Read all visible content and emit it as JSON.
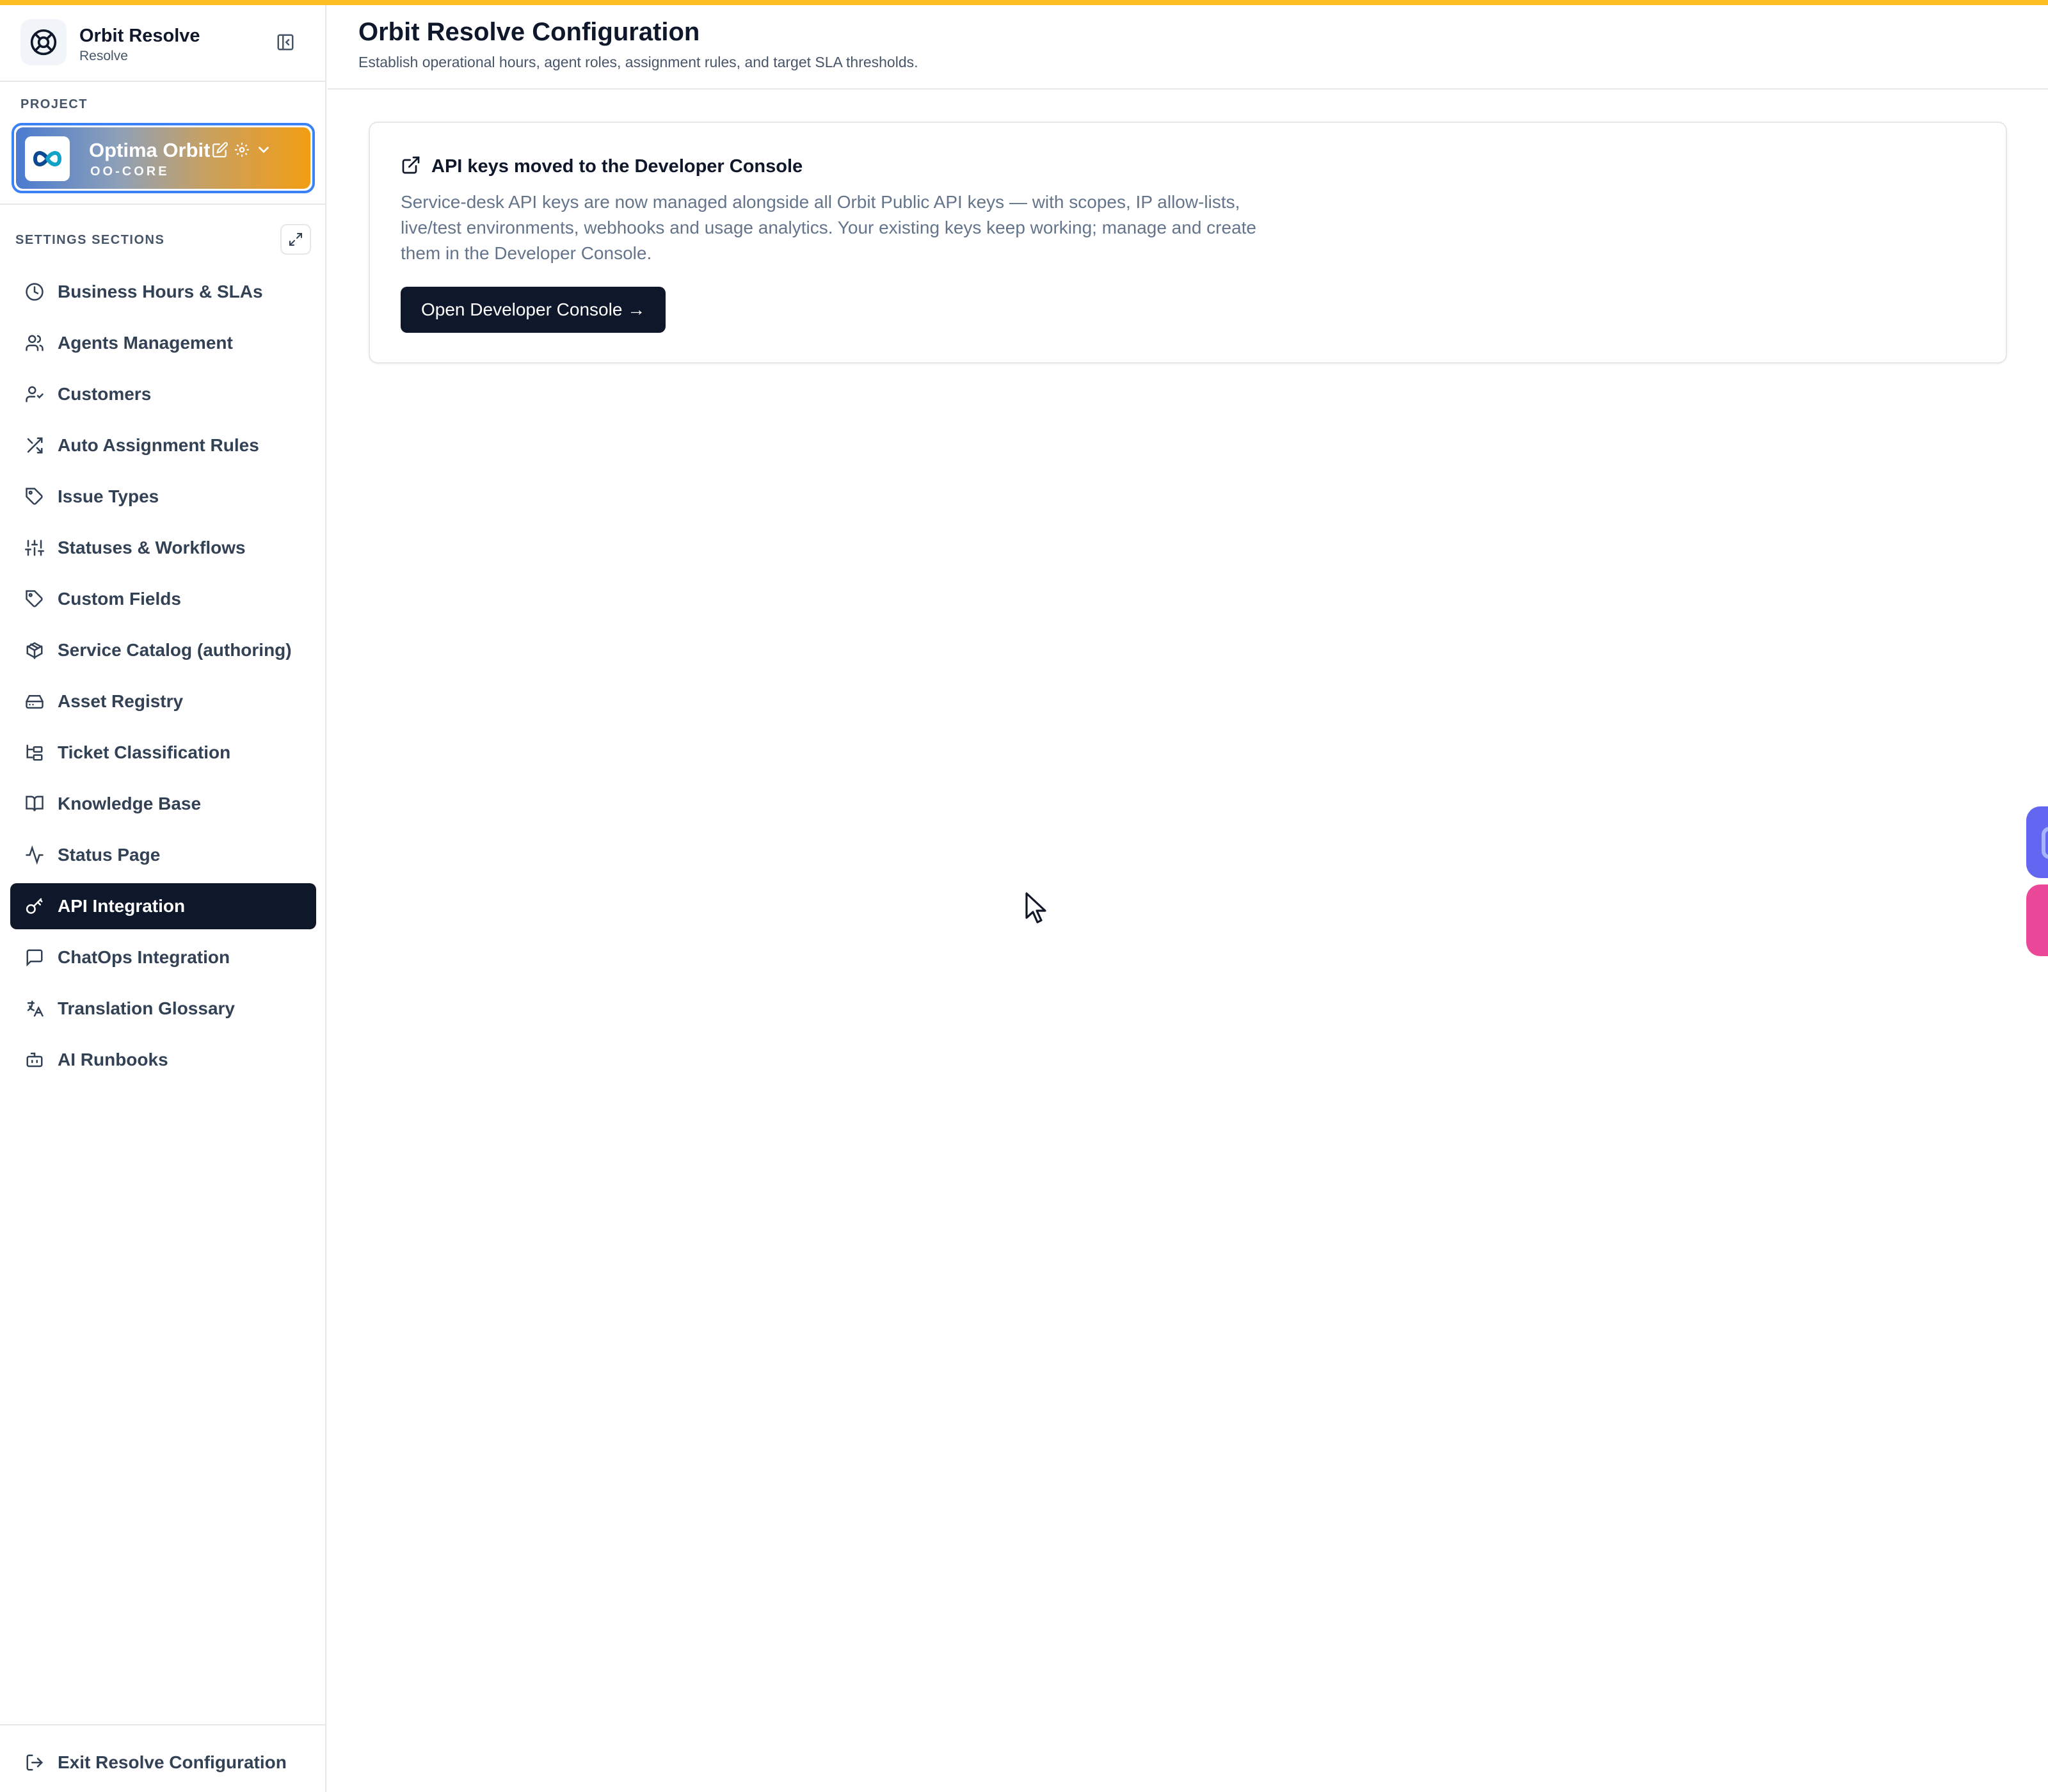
{
  "brand": {
    "title": "Orbit Resolve",
    "subtitle": "Resolve"
  },
  "project": {
    "section_label": "PROJECT",
    "name": "Optima Orbit",
    "code": "OO-CORE"
  },
  "sidebar": {
    "section_label": "SETTINGS SECTIONS",
    "items": [
      {
        "label": "Business Hours & SLAs",
        "icon": "clock-icon"
      },
      {
        "label": "Agents Management",
        "icon": "users-icon"
      },
      {
        "label": "Customers",
        "icon": "user-check-icon"
      },
      {
        "label": "Auto Assignment Rules",
        "icon": "shuffle-icon"
      },
      {
        "label": "Issue Types",
        "icon": "tag-icon"
      },
      {
        "label": "Statuses & Workflows",
        "icon": "sliders-icon"
      },
      {
        "label": "Custom Fields",
        "icon": "tag-icon"
      },
      {
        "label": "Service Catalog (authoring)",
        "icon": "package-icon"
      },
      {
        "label": "Asset Registry",
        "icon": "hard-drive-icon"
      },
      {
        "label": "Ticket Classification",
        "icon": "folder-tree-icon"
      },
      {
        "label": "Knowledge Base",
        "icon": "book-open-icon"
      },
      {
        "label": "Status Page",
        "icon": "activity-icon"
      },
      {
        "label": "API Integration",
        "icon": "key-icon",
        "active": true
      },
      {
        "label": "ChatOps Integration",
        "icon": "message-square-icon"
      },
      {
        "label": "Translation Glossary",
        "icon": "languages-icon"
      },
      {
        "label": "AI Runbooks",
        "icon": "bot-icon"
      }
    ],
    "exit_label": "Exit Resolve Configuration"
  },
  "header": {
    "title": "Orbit Resolve Configuration",
    "subtitle": "Establish operational hours, agent roles, assignment rules, and target SLA thresholds."
  },
  "notice": {
    "title": "API keys moved to the Developer Console",
    "body": "Service-desk API keys are now managed alongside all Orbit Public API keys — with scopes, IP allow-lists, live/test environments, webhooks and usage analytics. Your existing keys keep working; manage and create them in the Developer Console.",
    "button_label": "Open Developer Console →"
  },
  "colors": {
    "accent_bar": "#fbbf24",
    "active_nav": "#0f172a",
    "project_border": "#3b82f6",
    "float_primary": "#6366f1",
    "float_secondary": "#ec4899"
  }
}
